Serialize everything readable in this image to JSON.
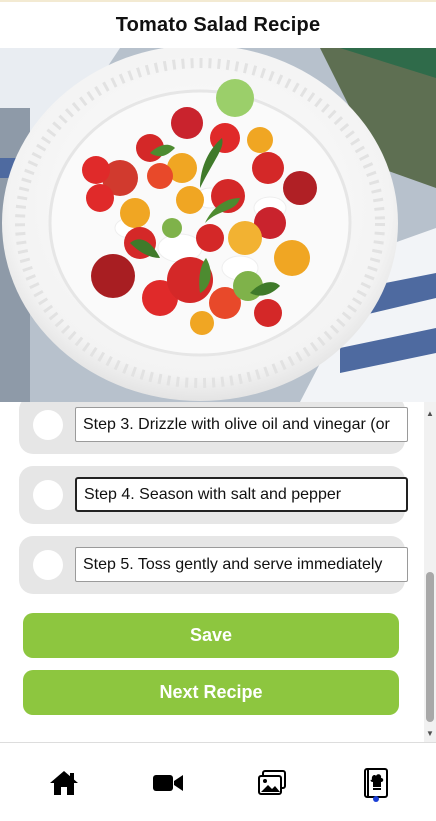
{
  "header": {
    "title": "Tomato Salad Recipe"
  },
  "photo": {
    "alt": "Tomato Salad"
  },
  "steps": [
    {
      "value": "Step 3. Drizzle with olive oil and vinegar (or",
      "completed": false
    },
    {
      "value": "Step 4. Season with salt and pepper",
      "completed": false
    },
    {
      "value": "Step 5. Toss gently and serve immediately",
      "completed": false
    }
  ],
  "actions": {
    "save_label": "Save",
    "next_label": "Next Recipe"
  },
  "nav": {
    "items": [
      {
        "icon": "home-icon"
      },
      {
        "icon": "video-camera-icon"
      },
      {
        "icon": "photos-icon"
      },
      {
        "icon": "recipe-book-icon",
        "active": true
      }
    ]
  },
  "colors": {
    "accent": "#8dc63f",
    "active_dot": "#1a3fd6",
    "row_bg": "#e6e6e6"
  }
}
